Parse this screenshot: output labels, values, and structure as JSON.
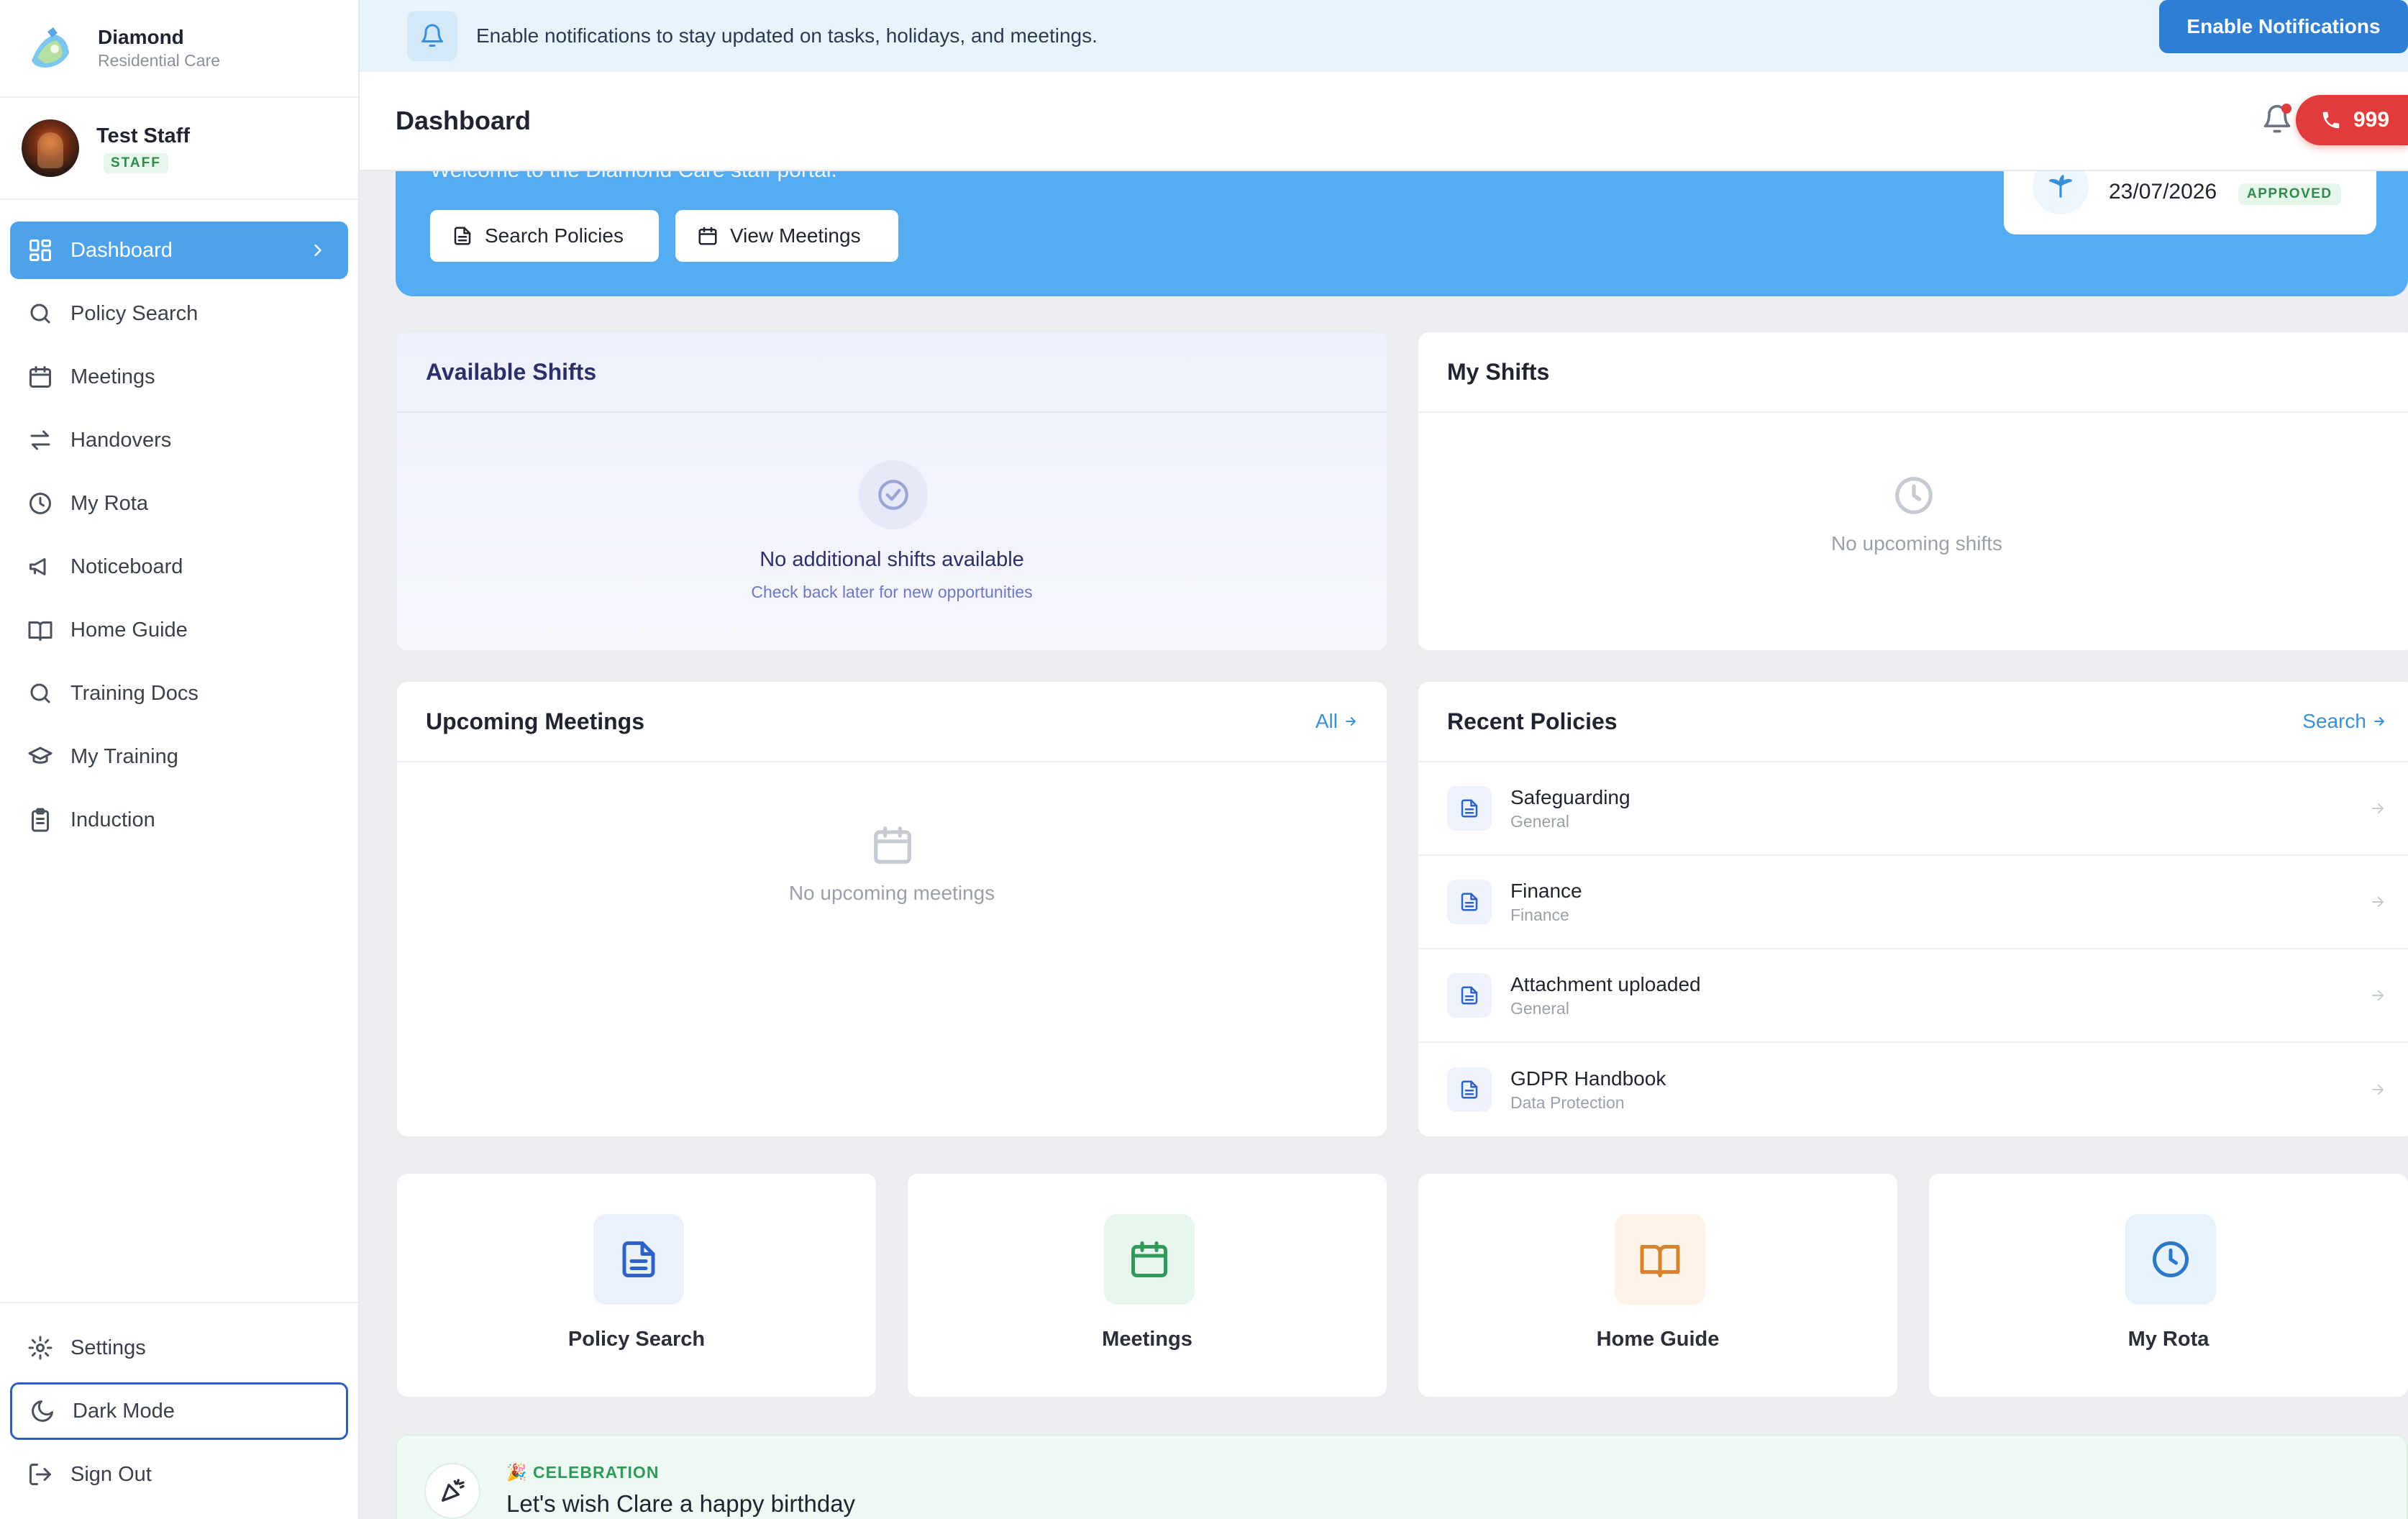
{
  "brand": {
    "name": "Diamond",
    "subtitle": "Residential Care"
  },
  "user": {
    "name": "Test Staff",
    "role": "STAFF"
  },
  "sidebar": {
    "items": [
      {
        "label": "Dashboard",
        "icon": "grid-icon",
        "active": true
      },
      {
        "label": "Policy Search",
        "icon": "search-icon"
      },
      {
        "label": "Meetings",
        "icon": "calendar-icon"
      },
      {
        "label": "Handovers",
        "icon": "swap-arrows-icon"
      },
      {
        "label": "My Rota",
        "icon": "clock-icon"
      },
      {
        "label": "Noticeboard",
        "icon": "megaphone-icon"
      },
      {
        "label": "Home Guide",
        "icon": "book-icon"
      },
      {
        "label": "Training Docs",
        "icon": "search-icon"
      },
      {
        "label": "My Training",
        "icon": "graduation-cap-icon"
      },
      {
        "label": "Induction",
        "icon": "clipboard-icon"
      }
    ],
    "bottom": [
      {
        "label": "Settings",
        "icon": "gear-icon"
      },
      {
        "label": "Dark Mode",
        "icon": "moon-icon"
      },
      {
        "label": "Sign Out",
        "icon": "sign-out-icon"
      }
    ]
  },
  "banner": {
    "text": "Enable notifications to stay updated on tasks, holidays, and meetings.",
    "button": "Enable Notifications"
  },
  "header": {
    "title": "Dashboard",
    "emergency_label": "999"
  },
  "hero": {
    "subtitle": "Welcome to the Diamond Care staff portal.",
    "buttons": [
      "Search Policies",
      "View Meetings"
    ],
    "leave": {
      "date": "23/07/2026",
      "status": "APPROVED"
    }
  },
  "available_shifts": {
    "title": "Available Shifts",
    "empty_title": "No additional shifts available",
    "empty_sub": "Check back later for new opportunities"
  },
  "my_shifts": {
    "title": "My Shifts",
    "empty": "No upcoming shifts"
  },
  "meetings": {
    "title": "Upcoming Meetings",
    "link": "All",
    "empty": "No upcoming meetings"
  },
  "policies": {
    "title": "Recent Policies",
    "link": "Search",
    "items": [
      {
        "title": "Safeguarding",
        "category": "General"
      },
      {
        "title": "Finance",
        "category": "Finance"
      },
      {
        "title": "Attachment uploaded",
        "category": "General"
      },
      {
        "title": "GDPR Handbook",
        "category": "Data Protection"
      }
    ]
  },
  "quick_links": [
    {
      "label": "Policy Search",
      "icon": "document-icon",
      "color": "#2f62c8",
      "bg": "#eaf1fb"
    },
    {
      "label": "Meetings",
      "icon": "calendar-icon",
      "color": "#2f9a5a",
      "bg": "#e8f6ee"
    },
    {
      "label": "Home Guide",
      "icon": "book-open-icon",
      "color": "#d9822b",
      "bg": "#fdf3e6"
    },
    {
      "label": "My Rota",
      "icon": "clock-icon",
      "color": "#2b78c8",
      "bg": "#e8f2fb"
    }
  ],
  "celebration": {
    "tag": "🎉 CELEBRATION",
    "title": "Let's wish Clare a happy birthday"
  },
  "colors": {
    "accent": "#4ea2ea",
    "hero": "#55acf0",
    "danger": "#e23b3b",
    "success": "#2f8a4e"
  }
}
